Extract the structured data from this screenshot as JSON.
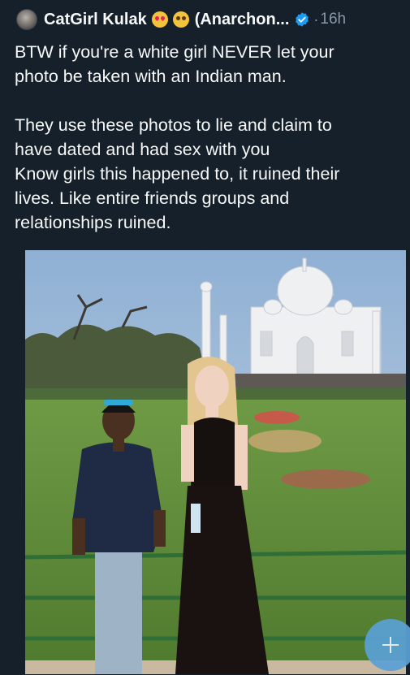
{
  "tweet": {
    "display_name": "CatGirl Kulak",
    "handle": "(Anarchon...",
    "separator": "·",
    "time": "16h",
    "lines_para1": [
      "BTW if you're a white girl NEVER let your",
      "photo be taken with an Indian man."
    ],
    "lines_para2": [
      "They use these photos to lie and claim to",
      "have dated and had sex with you",
      "Know girls this happened to, it ruined their",
      "lives. Like entire friends groups and",
      "relationships ruined."
    ]
  },
  "icons": {
    "emoji_1": "heart-eyes-cat-emoji-icon",
    "emoji_2": "crying-cat-emoji-icon",
    "verified": "verified-badge-icon",
    "media_overlay": "add-icon"
  },
  "colors": {
    "background": "#15202b",
    "text": "#f7f9f9",
    "secondary_text": "#8b98a5",
    "verified_blue": "#1d9bf0"
  }
}
